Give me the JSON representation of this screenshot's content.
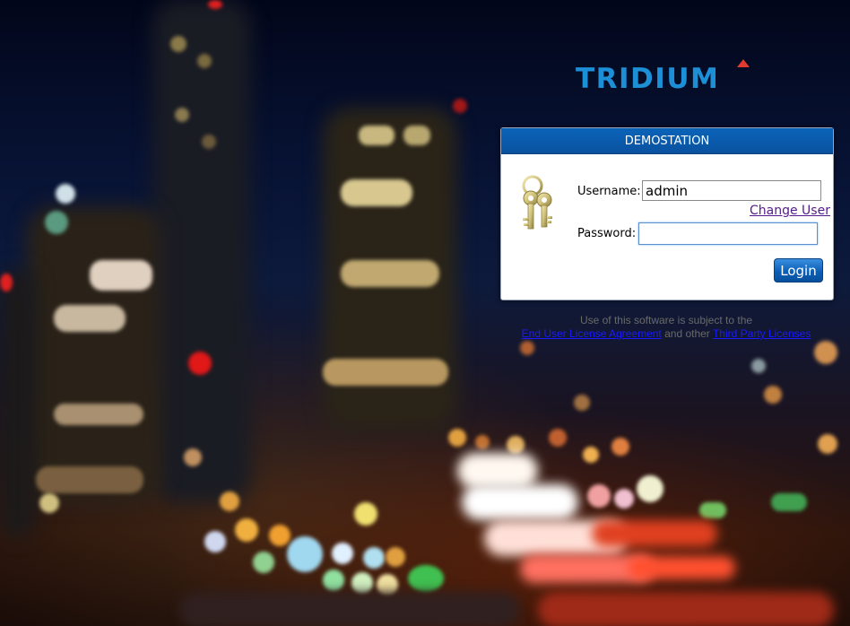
{
  "logo": {
    "text": "TRIDIUM"
  },
  "panel": {
    "title": "DEMOSTATION",
    "username_label": "Username:",
    "username_value": "admin",
    "change_user_label": "Change User",
    "password_label": "Password:",
    "password_value": "",
    "login_label": "Login"
  },
  "legal": {
    "line1": "Use of this software is subject to the",
    "eula_link": "End User License Agreement",
    "and_other": " and other ",
    "third_party_link": "Third Party Licenses"
  },
  "colors": {
    "brand_blue": "#1d8fd6",
    "brand_red": "#e23a2e",
    "header_blue": "#0a5aa8"
  }
}
